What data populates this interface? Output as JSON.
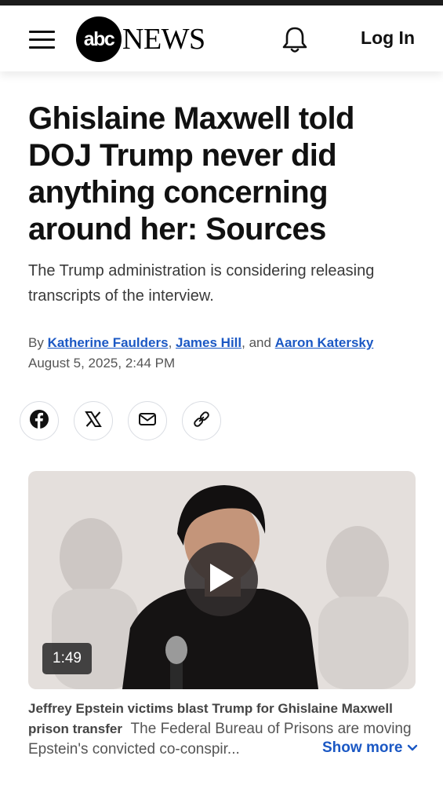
{
  "header": {
    "logo_mark": "abc",
    "logo_word": "NEWS",
    "login_label": "Log In"
  },
  "article": {
    "headline": "Ghislaine Maxwell told DOJ Trump never did anything concerning around her: Sources",
    "subhead": "The Trump administration is considering releasing transcripts of the interview.",
    "byline": {
      "prefix": "By ",
      "authors": [
        "Katherine Faulders",
        "James Hill",
        "Aaron Katersky"
      ],
      "sep1": ", ",
      "sep2": ", and ",
      "date": "August 5, 2025, 2:44 PM"
    }
  },
  "share": {
    "icons": [
      "facebook-icon",
      "x-icon",
      "mail-icon",
      "link-icon"
    ]
  },
  "video": {
    "duration": "1:49",
    "caption_title": "Jeffrey Epstein victims blast Trump for Ghislaine Maxwell prison transfer",
    "caption_text": "The Federal Bureau of Prisons are moving Epstein's convicted co-conspir...",
    "show_more_label": "Show more"
  },
  "colors": {
    "link": "#1b58c4",
    "text": "#111111",
    "muted": "#555555"
  }
}
